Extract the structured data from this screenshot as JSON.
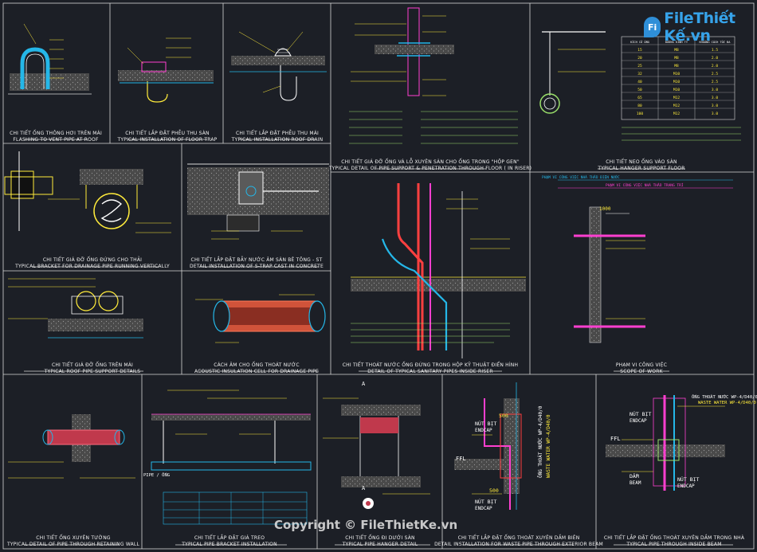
{
  "brand": {
    "logo_badge": "Fi",
    "logo_name": "FileThiết Kế.vn"
  },
  "watermark": "Copyright © FileThietKe.vn",
  "panels": [
    {
      "id": "p1",
      "title_vi": "CHI TIẾT ỐNG THÔNG HƠI TRÊN MÁI",
      "title_en": "FLASHING TO VENT PIPE AT ROOF"
    },
    {
      "id": "p2",
      "title_vi": "CHI TIẾT LẮP ĐẶT PHỄU THU SÀN",
      "title_en": "TYPICAL INSTALLATION OF FLOOR TRAP"
    },
    {
      "id": "p3",
      "title_vi": "CHI TIẾT LẮP ĐẶT PHỄU THU MÁI",
      "title_en": "TYPICAL INSTALLATION ROOF DRAIN"
    },
    {
      "id": "p4",
      "title_vi": "CHI TIẾT GIÁ ĐỠ ỐNG VÀ LỖ XUYÊN SÀN CHO ỐNG TRONG \"HỘP GEN\"",
      "title_en": "TYPICAL DETAIL OF PIPE SUPPORT & PENETRATION THROUGH FLOOR ( IN RISER)"
    },
    {
      "id": "p5",
      "title_vi": "CHI TIẾT NEO ỐNG VÀO SÀN",
      "title_en": "TYPICAL HANGER SUPPORT FLOOR"
    },
    {
      "id": "p6",
      "title_vi": "CHI TIẾT GIÁ ĐỠ ỐNG ĐỨNG CHO THẢI",
      "title_en": "TYPICAL BRACKET FOR DRAINAGE PIPE RUNNING VERTICALLY"
    },
    {
      "id": "p7",
      "title_vi": "CHI TIẾT LẮP ĐẶT BẪY NƯỚC ÂM SÀN BÊ TÔNG - ST",
      "title_en": "DETAIL INSTALLATION OF S-TRAP CAST IN CONCRETE"
    },
    {
      "id": "p8",
      "title_vi": "CHI TIẾT THOÁT NƯỚC ỐNG ĐỨNG TRONG HỘP KỸ THUẬT ĐIỂN HÌNH",
      "title_en": "DETAIL OF TYPICAL SANITARY PIPES INSIDE RISER"
    },
    {
      "id": "p9",
      "title_vi": "PHẠM VI CÔNG VIỆC",
      "title_en": "SCOPE OF WORK"
    },
    {
      "id": "p10",
      "title_vi": "CHI TIẾT GIÁ ĐỠ ỐNG TRÊN MÁI",
      "title_en": "TYPICAL ROOF PIPE SUPPORT DETAILS"
    },
    {
      "id": "p11",
      "title_vi": "CÁCH ÂM CHO ỐNG THOÁT NƯỚC",
      "title_en": "ACOUSTIC INSULATION CELL FOR DRAINAGE PIPE"
    },
    {
      "id": "p12",
      "title_vi": "CHI TIẾT ỐNG XUYÊN TƯỜNG",
      "title_en": "TYPICAL DETAIL OF PIPE THROUGH RETAINING WALL"
    },
    {
      "id": "p13",
      "title_vi": "CHI TIẾT LẮP ĐẶT GIÁ TREO",
      "title_en": "TYPICAL PIPE BRACKET INSTALLATION"
    },
    {
      "id": "p14",
      "title_vi": "CHI TIẾT ỐNG ĐI DƯỚI SÀN",
      "title_en": "TYPICAL PIPE HANGER DETAIL"
    },
    {
      "id": "p15",
      "title_vi": "CHI TIẾT LẮP ĐẶT ỐNG THOÁT XUYÊN DẦM BIÊN",
      "title_en": "DETAIL INSTALLATION FOR WASTE PIPE THROUGH EXTERIOR BEAM"
    },
    {
      "id": "p16",
      "title_vi": "CHI TIẾT LẮP ĐẶT ỐNG THOÁT XUYÊN DẦM TRONG NHÀ",
      "title_en": "TYPICAL PIPE THROUGH INSIDE BEAM"
    }
  ],
  "labels": {
    "pipe": "PIPE / ỐNG",
    "ffl": "FFL",
    "dam": "DẦM",
    "beam": "BEAM",
    "nut_bit": "NÚT BỊT",
    "endcap": "ENDCAP",
    "waste_water": "WASTE WATER WP-4/D40/0",
    "ong_thoat_nuoc": "ỐNG THOÁT NƯỚC WP-4/D40/0",
    "dim_500": "500",
    "dim_1000": "1000",
    "marker_a": "A",
    "scope_1": "PHẠM VI CÔNG VIỆC NHÀ THẦU ĐIỆN NƯỚC",
    "scope_2": "PHẠM VI CÔNG VIỆC NHÀ THẦU TRANG TRÍ"
  },
  "table": {
    "headers": [
      "KÍCH CỠ ỐNG",
      "ĐƯỜNG KÍNH TY",
      "KHOẢNG CÁCH TỐI ĐA"
    ],
    "rows": [
      [
        "15",
        "M8",
        "1.5"
      ],
      [
        "20",
        "M8",
        "2.0"
      ],
      [
        "25",
        "M8",
        "2.0"
      ],
      [
        "32",
        "M10",
        "2.5"
      ],
      [
        "40",
        "M10",
        "2.5"
      ],
      [
        "50",
        "M10",
        "3.0"
      ],
      [
        "65",
        "M12",
        "3.0"
      ],
      [
        "80",
        "M12",
        "3.0"
      ],
      [
        "100",
        "M12",
        "3.0"
      ]
    ]
  }
}
